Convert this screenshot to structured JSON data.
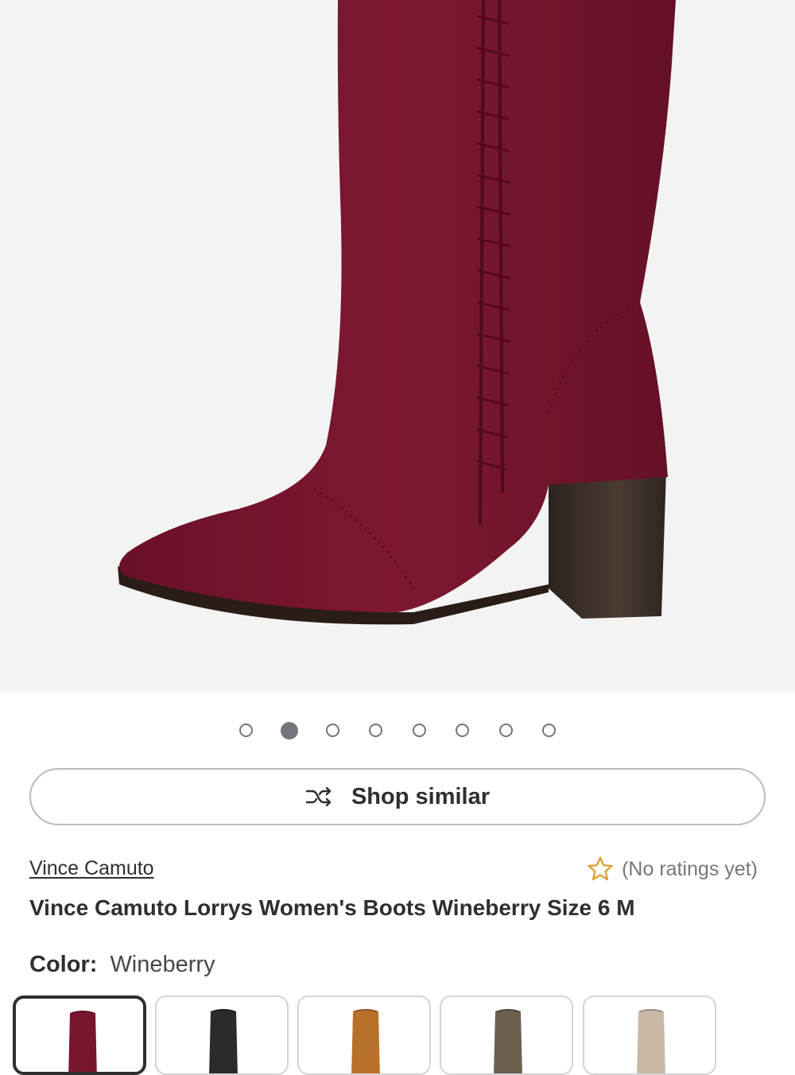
{
  "product": {
    "brand": "Vince Camuto",
    "title": "Vince Camuto Lorrys Women's Boots Wineberry Size 6 M",
    "rating_text": "(No ratings yet)",
    "color_label": "Color:",
    "color_value": "Wineberry"
  },
  "carousel": {
    "total_images": 8,
    "active_index": 1
  },
  "actions": {
    "shop_similar_label": "Shop similar",
    "shop_similar_icon": "shuffle-icon"
  },
  "swatches": [
    {
      "name": "Wineberry",
      "color": "#7a1530",
      "selected": true
    },
    {
      "name": "Black",
      "color": "#2b2b2b",
      "selected": false
    },
    {
      "name": "Cognac",
      "color": "#b8712a",
      "selected": false
    },
    {
      "name": "Olive",
      "color": "#6b5f4e",
      "selected": false
    },
    {
      "name": "Taupe",
      "color": "#c8b9a6",
      "selected": false
    }
  ],
  "colors": {
    "boot_main": "#7a1530",
    "boot_dark": "#5c0f24",
    "heel": "#3f332c",
    "text": "#2e2f32",
    "muted": "#74767c",
    "star": "#e0a03a"
  }
}
